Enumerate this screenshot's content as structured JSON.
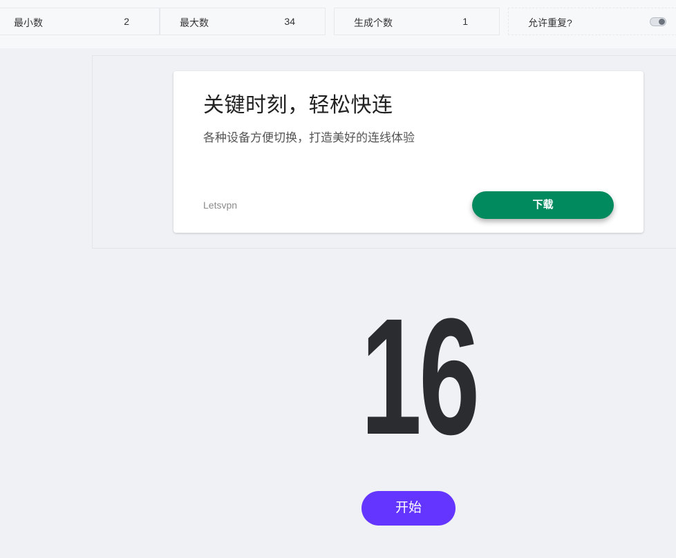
{
  "settings": {
    "min": {
      "label": "最小数",
      "value": "2"
    },
    "max": {
      "label": "最大数",
      "value": "34"
    },
    "count": {
      "label": "生成个数",
      "value": "1"
    },
    "allow_repeat": {
      "label": "允许重复?",
      "enabled": true
    }
  },
  "ad": {
    "title": "关键时刻，轻松快连",
    "subtitle": "各种设备方便切换，打造美好的连线体验",
    "brand": "Letsvpn",
    "button_label": "下载",
    "button_color": "#028a5f"
  },
  "result": {
    "number": "16"
  },
  "start_button": {
    "label": "开始",
    "color": "#6435ff"
  }
}
